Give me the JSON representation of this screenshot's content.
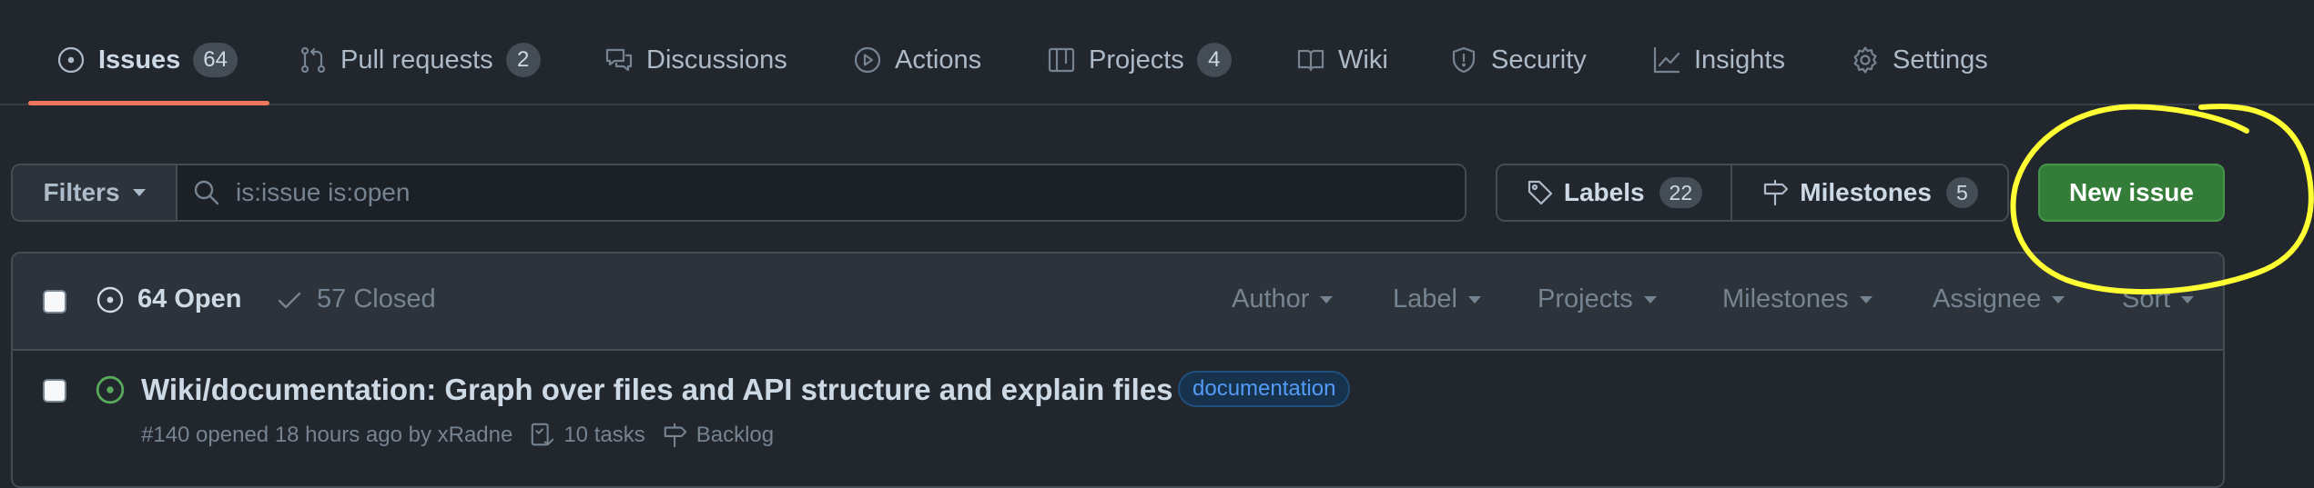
{
  "tabs": [
    {
      "label": "Issues",
      "count": "64",
      "icon": "issue-opened-icon"
    },
    {
      "label": "Pull requests",
      "count": "2",
      "icon": "git-pull-request-icon"
    },
    {
      "label": "Discussions",
      "icon": "comment-discussion-icon"
    },
    {
      "label": "Actions",
      "icon": "play-icon"
    },
    {
      "label": "Projects",
      "count": "4",
      "icon": "table-icon"
    },
    {
      "label": "Wiki",
      "icon": "book-icon"
    },
    {
      "label": "Security",
      "icon": "shield-icon"
    },
    {
      "label": "Insights",
      "icon": "graph-icon"
    },
    {
      "label": "Settings",
      "icon": "gear-icon"
    }
  ],
  "filter_bar": {
    "filters_label": "Filters",
    "search_value": "is:issue is:open",
    "labels_label": "Labels",
    "labels_count": "22",
    "milestones_label": "Milestones",
    "milestones_count": "5",
    "new_issue_label": "New issue"
  },
  "issues_header": {
    "open_label": "64 Open",
    "closed_label": "57 Closed",
    "filters": [
      "Author",
      "Label",
      "Projects",
      "Milestones",
      "Assignee",
      "Sort"
    ]
  },
  "issues": [
    {
      "title": "Wiki/documentation: Graph over files and API structure and explain files",
      "label": "documentation",
      "meta": "#140 opened 18 hours ago by xRadne",
      "tasks": "10 tasks",
      "milestone": "Backlog"
    }
  ],
  "colors": {
    "background": "#22272e",
    "accent_underline": "#ec775c",
    "new_issue_green": "#347d39",
    "open_icon_green": "#57ab5a",
    "label_blue": "#539bf5",
    "annotation_yellow": "#ffff33"
  }
}
